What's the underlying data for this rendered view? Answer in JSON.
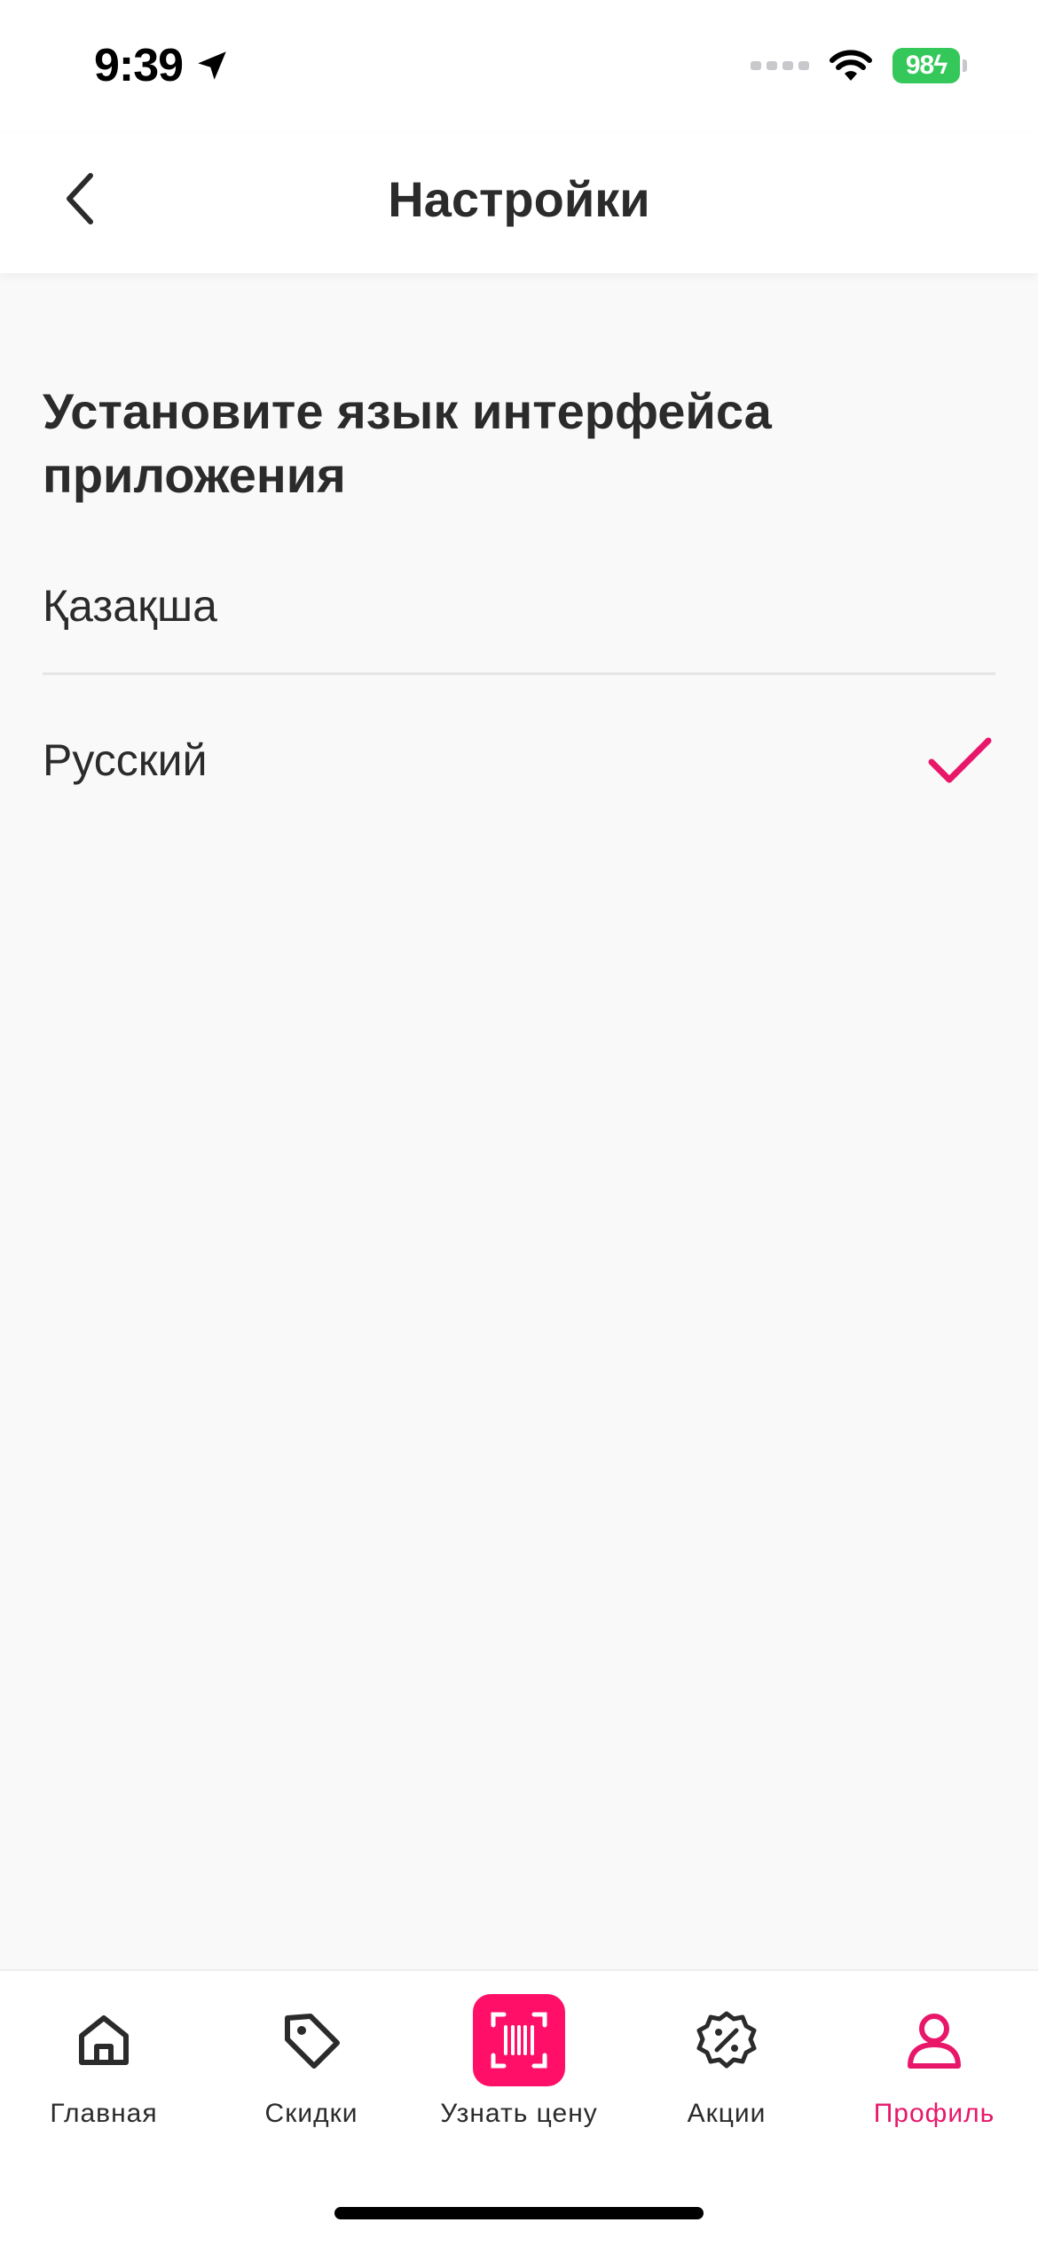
{
  "status_bar": {
    "time": "9:39",
    "battery": "98"
  },
  "header": {
    "title": "Настройки"
  },
  "language_section": {
    "heading": "Установите язык интерфейса приложения",
    "options": [
      {
        "label": "Қазақша",
        "selected": false
      },
      {
        "label": "Русский",
        "selected": true
      }
    ]
  },
  "tab_bar": {
    "tabs": [
      {
        "label": "Главная",
        "icon": "home-icon",
        "active": false
      },
      {
        "label": "Скидки",
        "icon": "tag-icon",
        "active": false
      },
      {
        "label": "Узнать цену",
        "icon": "barcode-scan-icon",
        "active": false
      },
      {
        "label": "Акции",
        "icon": "percent-badge-icon",
        "active": false
      },
      {
        "label": "Профиль",
        "icon": "profile-icon",
        "active": true
      }
    ]
  },
  "colors": {
    "accent": "#e8176a",
    "scan_button": "#ff0f68",
    "battery": "#34c759"
  }
}
